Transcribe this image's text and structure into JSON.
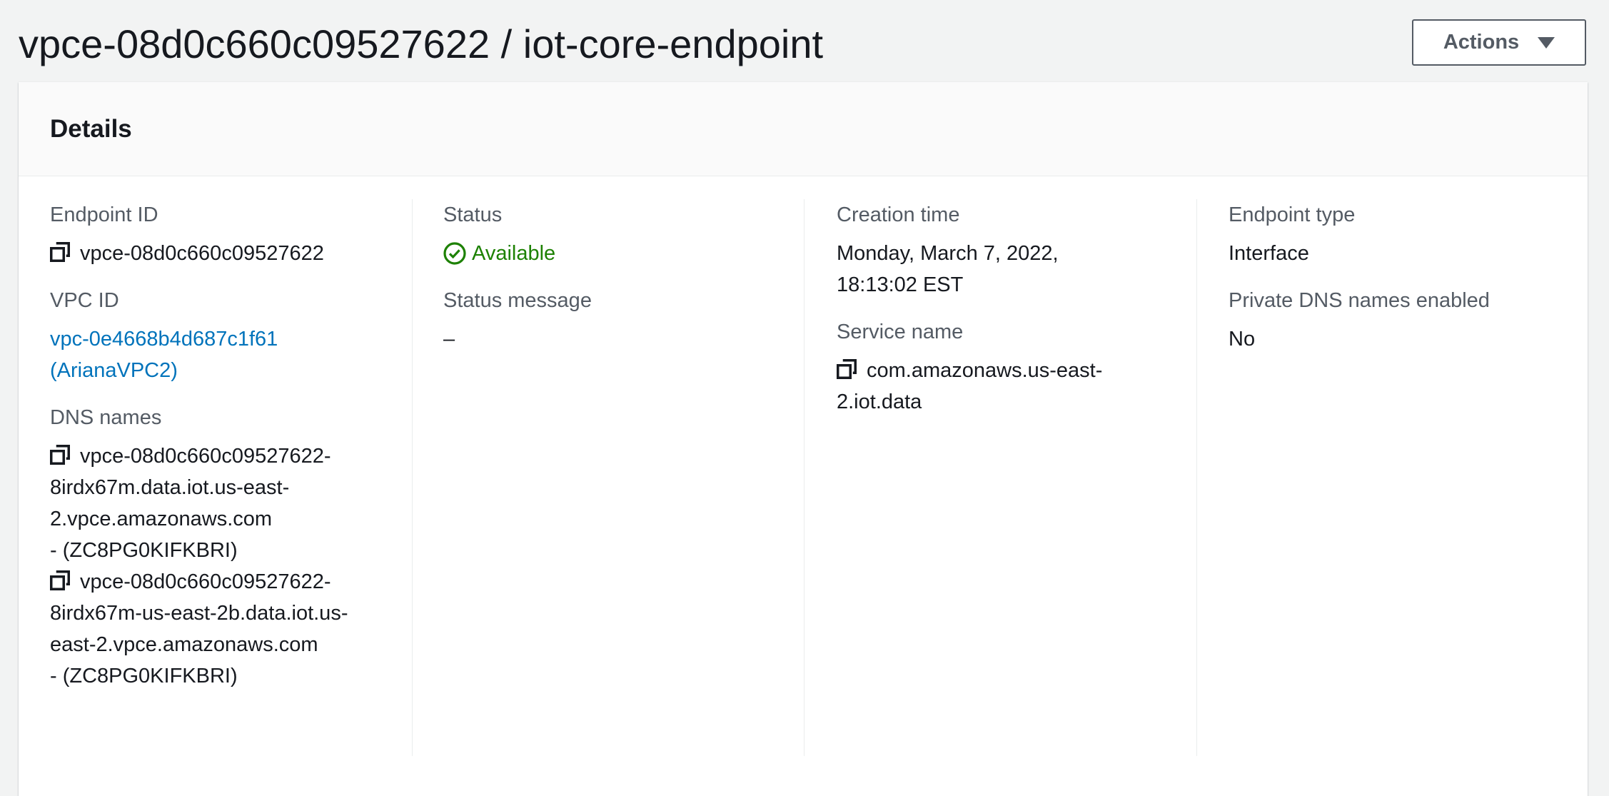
{
  "header": {
    "title": "vpce-08d0c660c09527622 / iot-core-endpoint",
    "actions_label": "Actions"
  },
  "panel": {
    "title": "Details"
  },
  "details": {
    "endpoint_id": {
      "label": "Endpoint ID",
      "value": "vpce-08d0c660c09527622"
    },
    "vpc_id": {
      "label": "VPC ID",
      "lines": [
        "vpc-0e4668b4d687c1f61",
        "(ArianaVPC2)"
      ]
    },
    "dns_names": {
      "label": "DNS names",
      "entries": [
        {
          "lines": [
            "vpce-08d0c660c09527622-",
            "8irdx67m.data.iot.us-east-",
            "2.vpce.amazonaws.com",
            "- (ZC8PG0KIFKBRI)"
          ]
        },
        {
          "lines": [
            "vpce-08d0c660c09527622-",
            "8irdx67m-us-east-2b.data.iot.us-",
            "east-2.vpce.amazonaws.com",
            "- (ZC8PG0KIFKBRI)"
          ]
        }
      ]
    },
    "status": {
      "label": "Status",
      "value": "Available",
      "color": "#1d8102"
    },
    "status_message": {
      "label": "Status message",
      "value": "–"
    },
    "creation_time": {
      "label": "Creation time",
      "lines": [
        "Monday, March 7, 2022,",
        "18:13:02 EST"
      ]
    },
    "service_name": {
      "label": "Service name",
      "lines": [
        "com.amazonaws.us-east-",
        "2.iot.data"
      ]
    },
    "endpoint_type": {
      "label": "Endpoint type",
      "value": "Interface"
    },
    "private_dns": {
      "label": "Private DNS names enabled",
      "value": "No"
    }
  }
}
